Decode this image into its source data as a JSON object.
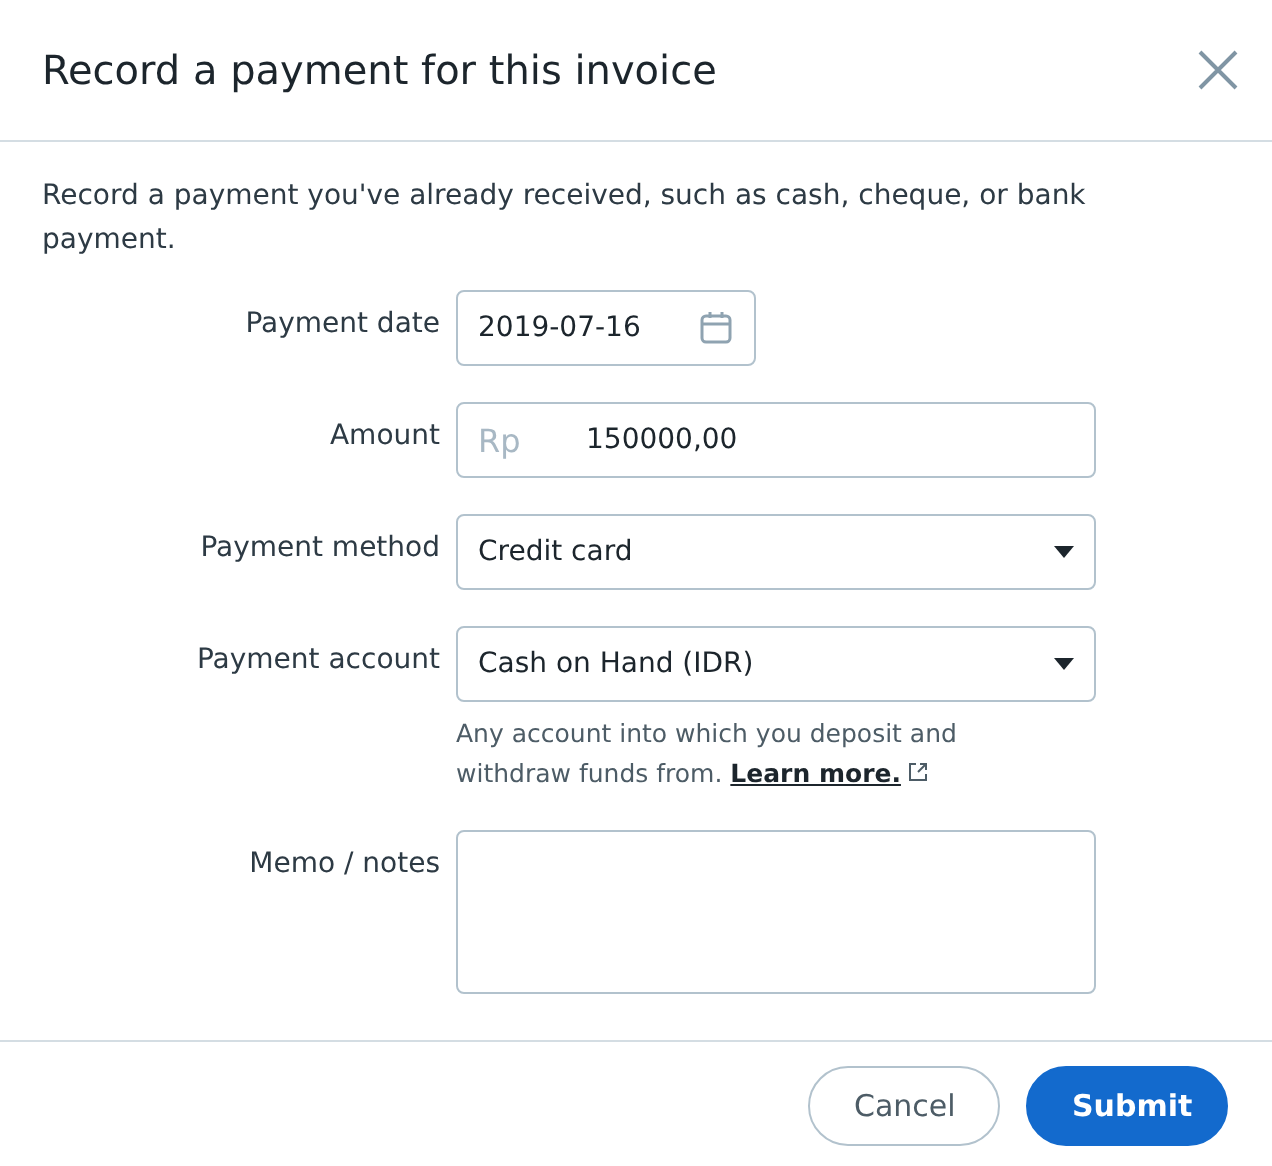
{
  "dialog": {
    "title": "Record a payment for this invoice"
  },
  "description": "Record a payment you've already received, such as cash, cheque, or bank payment.",
  "fields": [
    {
      "kind": "date",
      "label": "Payment date",
      "value": "2019-07-16"
    },
    {
      "kind": "amount",
      "label": "Amount",
      "prefix": "Rp",
      "value": "150000,00"
    },
    {
      "kind": "select",
      "label": "Payment method",
      "value": "Credit card"
    },
    {
      "kind": "select",
      "label": "Payment account",
      "value": "Cash on Hand (IDR)",
      "help": "Any account into which you deposit and withdraw funds from.",
      "help_link": "Learn more."
    },
    {
      "kind": "textarea",
      "label": "Memo / notes"
    }
  ],
  "buttons": [
    {
      "label": "Cancel",
      "kind": "secondary"
    },
    {
      "label": "Submit",
      "kind": "primary"
    }
  ]
}
